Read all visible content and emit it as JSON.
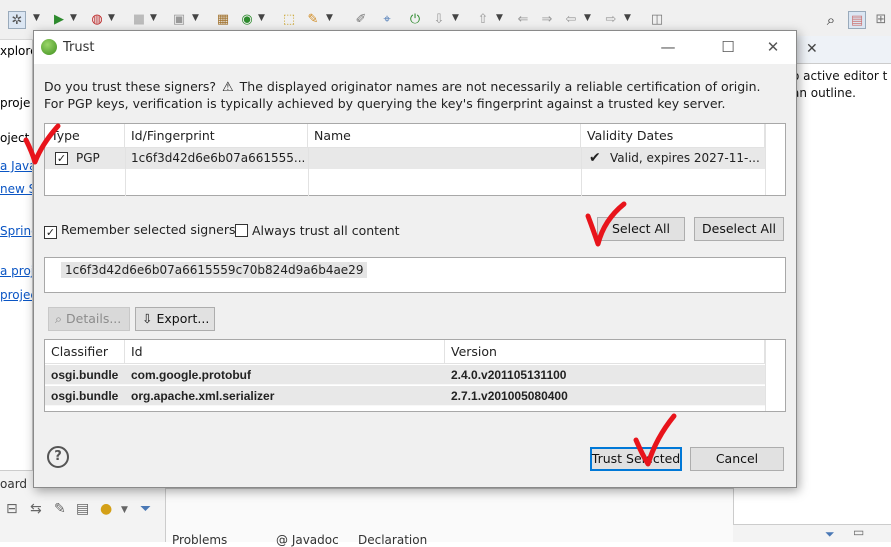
{
  "background": {
    "left_panel_lines": [
      "xplore",
      "proje",
      "oject",
      "a Java",
      "new S",
      "Spring",
      "a proj",
      "projec"
    ],
    "right_panel_message": [
      "o active editor t",
      "an outline."
    ],
    "bottom_left_title": "oard",
    "bottom_tabs": [
      "Problems",
      "@ Javadoc",
      "Declaration"
    ]
  },
  "dialog": {
    "title": "Trust",
    "intro_before_icon": "Do you trust these signers?",
    "intro_after_icon": "The displayed originator names are not necessarily a reliable certification of origin.  For PGP keys, verification is typically achieved by querying the key's fingerprint against a trusted key server.",
    "signers": {
      "headers": [
        "Type",
        "Id/Fingerprint",
        "Name",
        "Validity Dates"
      ],
      "rows": [
        {
          "type": "PGP",
          "id": "1c6f3d42d6e6b07a661555...",
          "name": "",
          "validity": "Valid, expires 2027-11-..."
        }
      ]
    },
    "remember_label": "Remember selected signers",
    "always_trust_label": "Always trust all content",
    "select_all": "Select All",
    "deselect_all": "Deselect All",
    "fingerprint": "1c6f3d42d6e6b07a6615559c70b824d9a6b4ae29",
    "details_label": "Details...",
    "export_label": "Export...",
    "artifacts": {
      "headers": [
        "Classifier",
        "Id",
        "Version"
      ],
      "rows": [
        {
          "classifier": "osgi.bundle",
          "id": "com.google.protobuf",
          "version": "2.4.0.v201105131100"
        },
        {
          "classifier": "osgi.bundle",
          "id": "org.apache.xml.serializer",
          "version": "2.7.1.v201005080400"
        }
      ]
    },
    "trust_selected": "Trust Selected",
    "cancel": "Cancel"
  },
  "colors": {
    "annotation": "#e8141b",
    "default_button_border": "#0078d7",
    "selected_row": "#e8e8e8"
  }
}
